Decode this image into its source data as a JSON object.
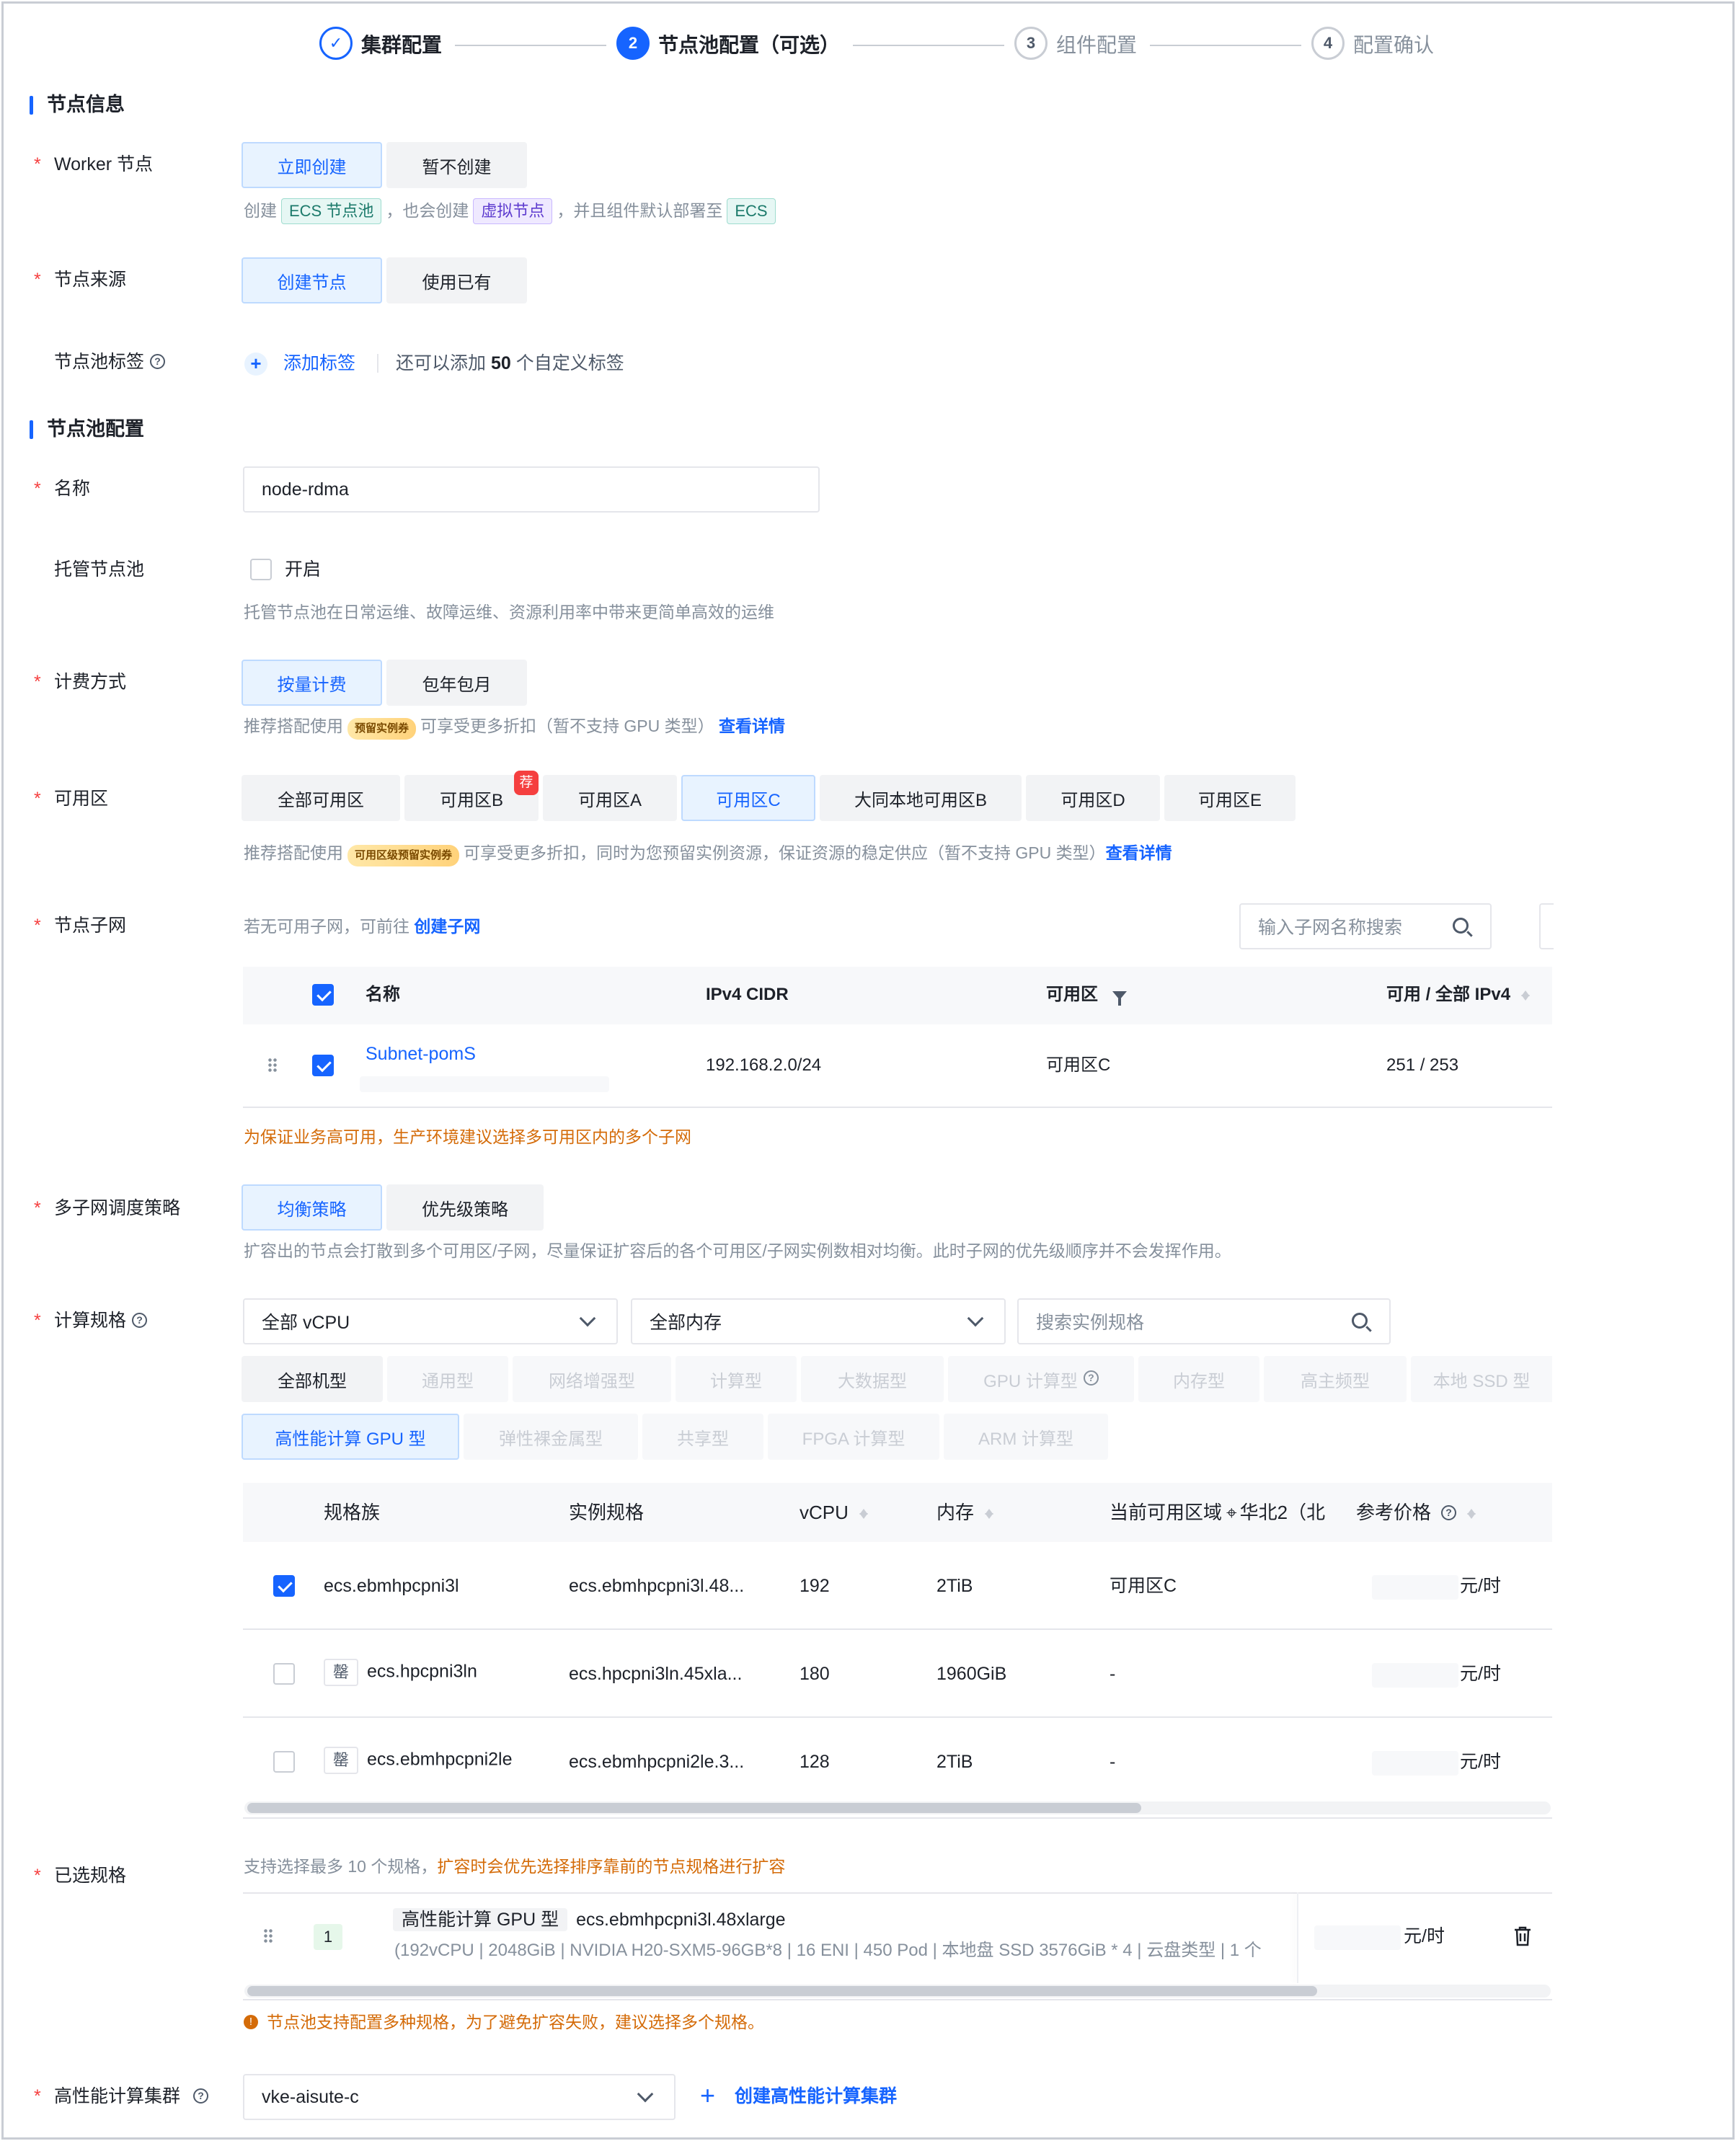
{
  "steps": [
    {
      "num": "✓",
      "label": "集群配置",
      "state": "done"
    },
    {
      "num": "2",
      "label": "节点池配置（可选）",
      "state": "active"
    },
    {
      "num": "3",
      "label": "组件配置",
      "state": "todo"
    },
    {
      "num": "4",
      "label": "配置确认",
      "state": "todo"
    }
  ],
  "sections": {
    "node_info": "节点信息",
    "pool_config": "节点池配置"
  },
  "required_mark": "*",
  "worker": {
    "label": "Worker 节点",
    "options": [
      "立即创建",
      "暂不创建"
    ],
    "selected": "立即创建",
    "hint_prefix": "创建",
    "tag_ecs_pool": "ECS 节点池",
    "hint_mid": "，也会创建",
    "tag_virtual": "虚拟节点",
    "hint_mid2": "，并且组件默认部署至",
    "tag_ecs": "ECS"
  },
  "source": {
    "label": "节点来源",
    "options": [
      "创建节点",
      "使用已有"
    ],
    "selected": "创建节点"
  },
  "tags": {
    "label": "节点池标签",
    "add_label": "添加标签",
    "remain_prefix": "还可以添加",
    "remain_count": "50",
    "remain_suffix": "个自定义标签"
  },
  "name": {
    "label": "名称",
    "value": "node-rdma"
  },
  "managed": {
    "label": "托管节点池",
    "checkbox_label": "开启",
    "hint": "托管节点池在日常运维、故障运维、资源利用率中带来更简单高效的运维"
  },
  "billing": {
    "label": "计费方式",
    "options": [
      "按量计费",
      "包年包月"
    ],
    "selected": "按量计费",
    "hint_prefix": "推荐搭配使用",
    "coupon": "预留实例券",
    "hint_suffix": "可享受更多折扣（暂不支持 GPU 类型）",
    "link": "查看详情"
  },
  "zone": {
    "label": "可用区",
    "options": [
      "全部可用区",
      "可用区B",
      "可用区A",
      "可用区C",
      "大同本地可用区B",
      "可用区D",
      "可用区E"
    ],
    "selected": "可用区C",
    "recommend_badge": "荐",
    "hint_prefix": "推荐搭配使用",
    "coupon": "可用区级预留实例券",
    "hint_suffix": "可享受更多折扣，同时为您预留实例资源，保证资源的稳定供应（暂不支持 GPU 类型）",
    "link": "查看详情"
  },
  "subnet": {
    "label": "节点子网",
    "hint_prefix": "若无可用子网，可前往",
    "create_link": "创建子网",
    "search_placeholder": "输入子网名称搜索",
    "columns": [
      "名称",
      "IPv4 CIDR",
      "可用区",
      "可用 / 全部 IPv4"
    ],
    "rows": [
      {
        "name": "Subnet-pomS",
        "cidr": "192.168.2.0/24",
        "zone": "可用区C",
        "ipv4": "251 / 253"
      }
    ],
    "warning": "为保证业务高可用，生产环境建议选择多可用区内的多个子网"
  },
  "policy": {
    "label": "多子网调度策略",
    "options": [
      "均衡策略",
      "优先级策略"
    ],
    "selected": "均衡策略",
    "hint": "扩容出的节点会打散到多个可用区/子网，尽量保证扩容后的各个可用区/子网实例数相对均衡。此时子网的优先级顺序并不会发挥作用。"
  },
  "spec": {
    "label": "计算规格",
    "vcpu_select": "全部 vCPU",
    "mem_select": "全部内存",
    "search_placeholder": "搜索实例规格",
    "types_row1": [
      "全部机型",
      "通用型",
      "网络增强型",
      "计算型",
      "大数据型",
      "GPU 计算型",
      "内存型",
      "高主频型",
      "本地 SSD 型"
    ],
    "types_row2": [
      "高性能计算 GPU 型",
      "弹性裸金属型",
      "共享型",
      "FPGA 计算型",
      "ARM 计算型"
    ],
    "selected_type": "高性能计算 GPU 型",
    "columns": [
      "规格族",
      "实例规格",
      "vCPU",
      "内存",
      "当前可用区域",
      "华北2（北",
      "参考价格"
    ],
    "rows": [
      {
        "family": "ecs.ebmhpcpni3l",
        "spec": "ecs.ebmhpcpni3l.48...",
        "vcpu": "192",
        "mem": "2TiB",
        "zone": "可用区C",
        "price": "元/时",
        "checked": true,
        "badge": ""
      },
      {
        "family": "ecs.hpcpni3ln",
        "spec": "ecs.hpcpni3ln.45xla...",
        "vcpu": "180",
        "mem": "1960GiB",
        "zone": "-",
        "price": "元/时",
        "checked": false,
        "badge": "罄"
      },
      {
        "family": "ecs.ebmhpcpni2le",
        "spec": "ecs.ebmhpcpni2le.3...",
        "vcpu": "128",
        "mem": "2TiB",
        "zone": "-",
        "price": "元/时",
        "checked": false,
        "badge": "罄"
      }
    ]
  },
  "selected_spec": {
    "label": "已选规格",
    "hint_prefix": "支持选择最多 10 个规格，",
    "hint_warn": "扩容时会优先选择排序靠前的节点规格进行扩容",
    "index": "1",
    "type_tag": "高性能计算 GPU 型",
    "name": "ecs.ebmhpcpni3l.48xlarge",
    "detail": "(192vCPU | 2048GiB | NVIDIA H20-SXM5-96GB*8 | 16 ENI | 450 Pod | 本地盘 SSD 3576GiB * 4 | 云盘类型 | 1 个",
    "price": "元/时",
    "warning": "节点池支持配置多种规格，为了避免扩容失败，建议选择多个规格。"
  },
  "hpc": {
    "label": "高性能计算集群",
    "value": "vke-aisute-c",
    "create_link": "创建高性能计算集群"
  },
  "colors": {
    "primary": "#1664ff",
    "warn": "#d46b08",
    "required": "#f53f3f"
  }
}
